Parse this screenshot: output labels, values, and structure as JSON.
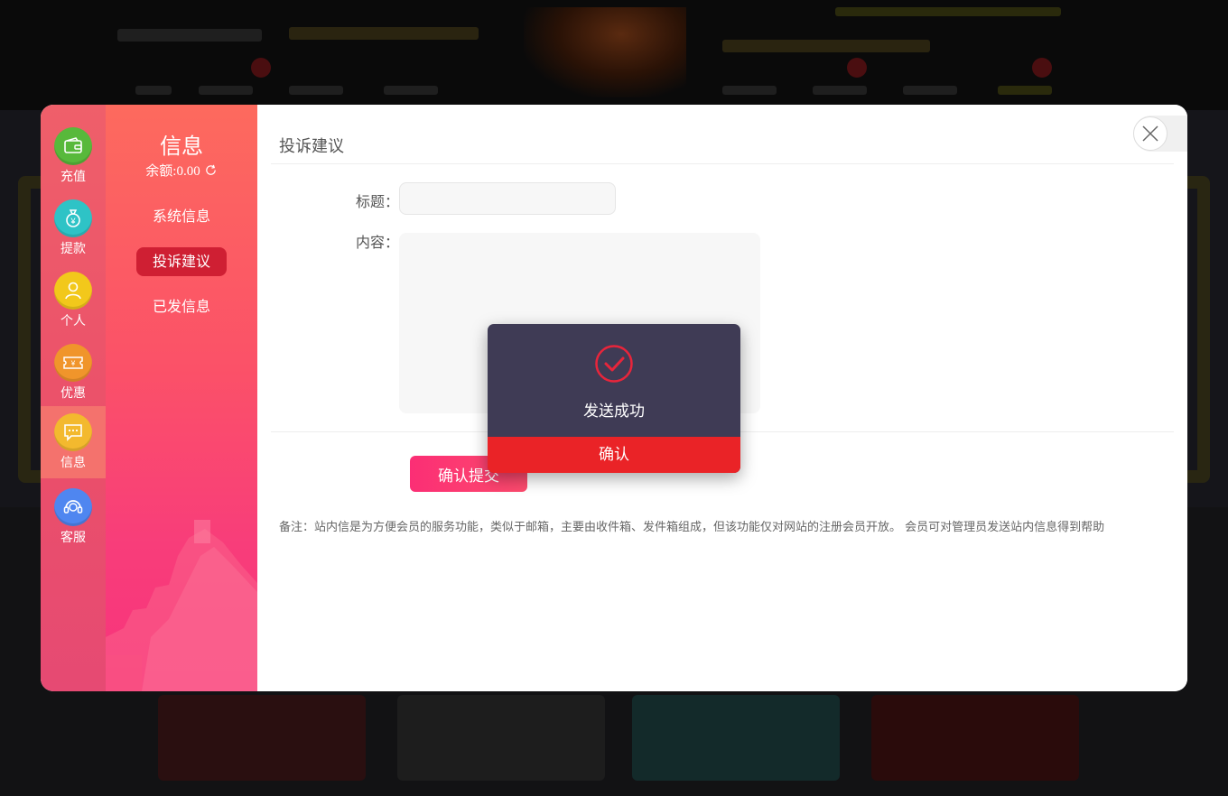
{
  "rail": {
    "items": [
      {
        "label": "充值",
        "icon": "wallet-icon",
        "color": "#58b93b"
      },
      {
        "label": "提款",
        "icon": "money-bag-icon",
        "color": "#2ec3c6"
      },
      {
        "label": "个人",
        "icon": "user-icon",
        "color": "#f2c81b"
      },
      {
        "label": "优惠",
        "icon": "ticket-icon",
        "color": "#f0952b"
      },
      {
        "label": "信息",
        "icon": "message-icon",
        "color": "#f3b92e",
        "active": true
      },
      {
        "label": "客服",
        "icon": "headset-icon",
        "color": "#4f86f0"
      }
    ]
  },
  "subnav": {
    "title": "信息",
    "balance": "余额:0.00",
    "items": [
      {
        "label": "系统信息"
      },
      {
        "label": "投诉建议",
        "active": true
      },
      {
        "label": "已发信息"
      }
    ]
  },
  "content": {
    "page_title": "投诉建议",
    "title_label": "标题：",
    "title_value": "",
    "body_label": "内容：",
    "body_value": "",
    "submit_label": "确认提交",
    "note": "备注：站内信是为方便会员的服务功能，类似于邮箱，主要由收件箱、发件箱组成，但该功能仅对网站的注册会员开放。 会员可对管理员发送站内信息得到帮助"
  },
  "dialog": {
    "icon": "check-circle-icon",
    "message": "发送成功",
    "ok_label": "确认"
  },
  "colors": {
    "accent": "#f7337c",
    "active_tab": "#cf1f33",
    "dialog_bg": "#3f3b55",
    "dialog_button": "#ea2327"
  }
}
